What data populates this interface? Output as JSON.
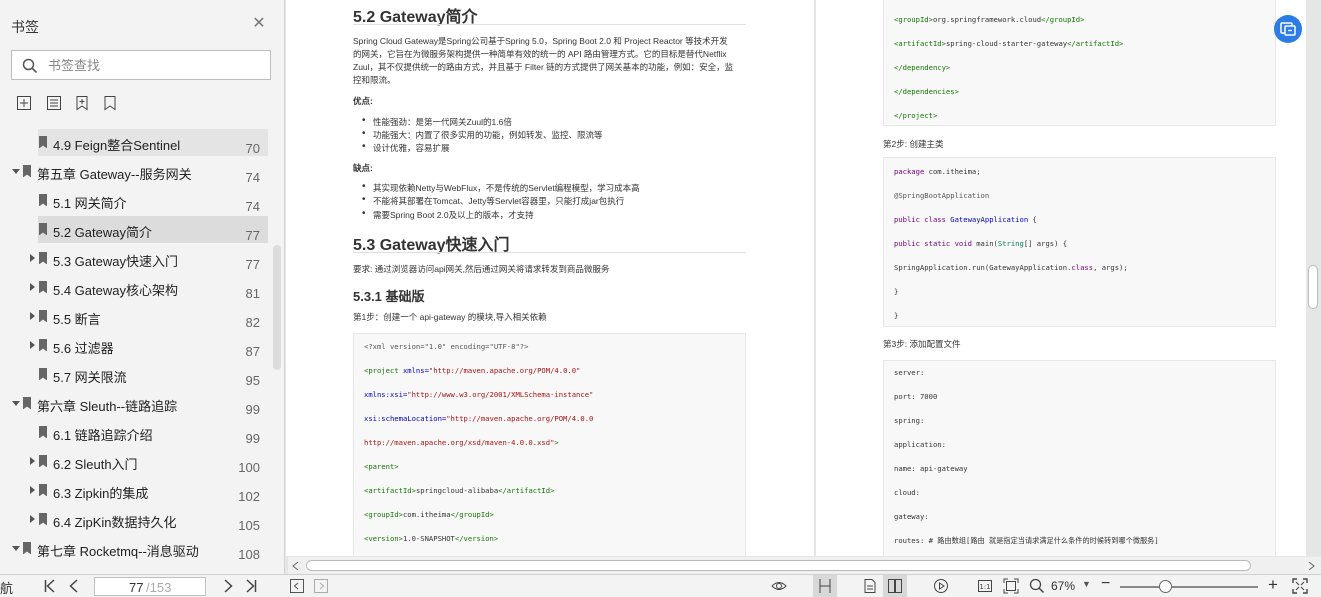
{
  "sidebar": {
    "title": "书签",
    "search_placeholder": "书签查找",
    "items": [
      {
        "label": "4.9 Feign整合Sentinel",
        "page": "70",
        "level": 2,
        "arrow": "none",
        "state": "sel2"
      },
      {
        "label": "第五章 Gateway--服务网关",
        "page": "74",
        "level": 1,
        "arrow": "down",
        "state": ""
      },
      {
        "label": "5.1 网关简介",
        "page": "74",
        "level": 2,
        "arrow": "none",
        "state": ""
      },
      {
        "label": "5.2 Gateway简介",
        "page": "77",
        "level": 2,
        "arrow": "none",
        "state": "sel"
      },
      {
        "label": "5.3 Gateway快速入门",
        "page": "77",
        "level": 2,
        "arrow": "right",
        "state": ""
      },
      {
        "label": "5.4 Gateway核心架构",
        "page": "81",
        "level": 2,
        "arrow": "right",
        "state": ""
      },
      {
        "label": "5.5 断言",
        "page": "82",
        "level": 2,
        "arrow": "right",
        "state": ""
      },
      {
        "label": "5.6 过滤器",
        "page": "87",
        "level": 2,
        "arrow": "right",
        "state": ""
      },
      {
        "label": "5.7 网关限流",
        "page": "95",
        "level": 2,
        "arrow": "none",
        "state": ""
      },
      {
        "label": "第六章 Sleuth--链路追踪",
        "page": "99",
        "level": 1,
        "arrow": "down",
        "state": ""
      },
      {
        "label": "6.1 链路追踪介绍",
        "page": "99",
        "level": 2,
        "arrow": "none",
        "state": ""
      },
      {
        "label": "6.2 Sleuth入门",
        "page": "100",
        "level": 2,
        "arrow": "right",
        "state": ""
      },
      {
        "label": "6.3 Zipkin的集成",
        "page": "102",
        "level": 2,
        "arrow": "right",
        "state": ""
      },
      {
        "label": "6.4 ZipKin数据持久化",
        "page": "105",
        "level": 2,
        "arrow": "right",
        "state": ""
      },
      {
        "label": "第七章 Rocketmq--消息驱动",
        "page": "108",
        "level": 1,
        "arrow": "down",
        "state": ""
      }
    ]
  },
  "left_page": {
    "h_52": "5.2 Gateway简介",
    "intro_1": "Spring Cloud Gateway是Spring公司基于Spring 5.0，Spring Boot 2.0 和 Project Reactor 等技术开发",
    "intro_2": "的网关，它旨在为微服务架构提供一种简单有效的统一的 API 路由管理方式。它的目标是替代Netflix",
    "intro_3": "Zuul，其不仅提供统一的路由方式，并且基于 Filter 链的方式提供了网关基本的功能，例如：安全，监",
    "intro_4": "控和限流。",
    "pros_title": "优点:",
    "pros": [
      "性能强劲：是第一代网关Zuul的1.6倍",
      "功能强大：内置了很多实用的功能，例如转发、监控、限流等",
      "设计优雅，容易扩展"
    ],
    "cons_title": "缺点:",
    "cons": [
      "其实现依赖Netty与WebFlux，不是传统的Servlet编程模型，学习成本高",
      "不能将其部署在Tomcat、Jetty等Servlet容器里，只能打成jar包执行",
      "需要Spring Boot 2.0及以上的版本，才支持"
    ],
    "h_53": "5.3 Gateway快速入门",
    "req": "要求: 通过浏览器访问api网关,然后通过网关将请求转发到商品微服务",
    "h_531": "5.3.1 基础版",
    "step1": "第1步：创建一个 api-gateway 的模块,导入相关依赖",
    "code": {
      "l1": "<?xml version=\"1.0\" encoding=\"UTF-8\"?>",
      "l2_tag": "<project ",
      "l2_attr": "xmlns=",
      "l2_str": "\"http://maven.apache.org/POM/4.0.0\"",
      "l3_attr": "xmlns:xsi=",
      "l3_str": "\"http://www.w3.org/2001/XMLSchema-instance\"",
      "l4_attr": "xsi:schemaLocation=",
      "l4_str": "\"http://maven.apache.org/POM/4.0.0",
      "l5_str": "http://maven.apache.org/xsd/maven-4.0.0.xsd\"",
      "l5_tag": ">",
      "l6_tag": "<parent>",
      "l7_tag1": "<artifactId>",
      "l7_val": "springcloud-alibaba",
      "l7_tag2": "</artifactId>",
      "l8_tag1": "<groupId>",
      "l8_val": "com.itheima",
      "l8_tag2": "</groupId>",
      "l9_tag1": "<version>",
      "l9_val": "1.0-SNAPSHOT",
      "l9_tag2": "</version>"
    }
  },
  "right_page": {
    "code1": {
      "l1_tag1": "<groupId>",
      "l1_val": "org.springframework.cloud",
      "l1_tag2": "</groupId>",
      "l2_tag1": "<artifactId>",
      "l2_val": "spring-cloud-starter-gateway",
      "l2_tag2": "</artifactId>",
      "l3": "</dependency>",
      "l4": "</dependencies>",
      "l5": "</project>"
    },
    "step2": "第2步: 创建主类",
    "code2": {
      "l1_kw": "package",
      "l1_rest": " com.itheima;",
      "l2": "@SpringBootApplication",
      "l3_kw": "public class",
      "l3_ty": " GatewayApplication",
      "l3_rest": " {",
      "l4_kw": "public static void",
      "l4_m": " main(",
      "l4_ty": "String",
      "l4_rest": "[] args) {",
      "l5_a": "SpringApplication.run(GatewayApplication.",
      "l5_kw": "class",
      "l5_b": ", args);",
      "l6": "}",
      "l7": "}"
    },
    "step3": "第3步: 添加配置文件",
    "code3": [
      "server:",
      "port: 7000",
      "spring:",
      "application:",
      "name: api-gateway",
      "cloud:",
      "gateway:",
      "routes: # 路由数组[路由 就是指定当请求满足什么条件的时候转到哪个微服务]"
    ]
  },
  "bottombar": {
    "nav_label": "航",
    "current_page": "77",
    "total_pages": "/153",
    "zoom": "67%"
  }
}
